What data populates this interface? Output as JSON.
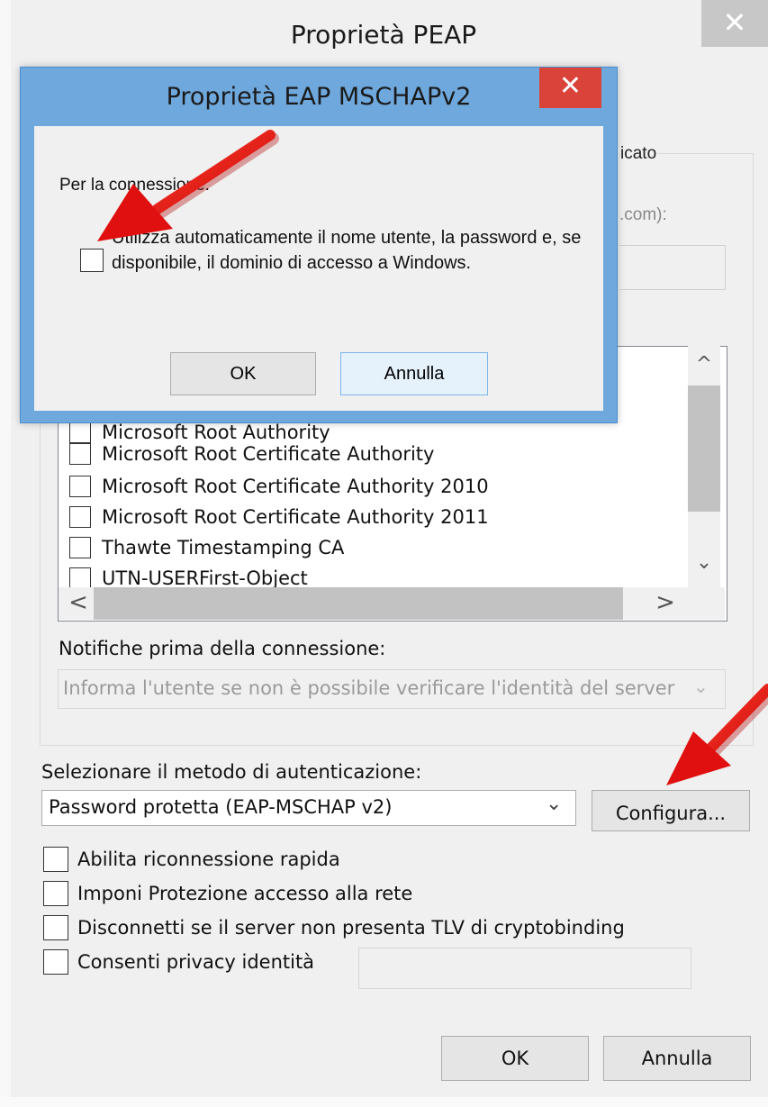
{
  "outer_window": {
    "title": "Proprietà PEAP",
    "close_glyph": "✕",
    "group_label_fragment": "icato",
    "server_label_fragment": ".com):",
    "cert_list": [
      {
        "label": "Microsoft Root Authority",
        "checked": false
      },
      {
        "label": "Microsoft Root Certificate Authority",
        "checked": false
      },
      {
        "label": "Microsoft Root Certificate Authority 2010",
        "checked": false
      },
      {
        "label": "Microsoft Root Certificate Authority 2011",
        "checked": false
      },
      {
        "label": "Thawte Timestamping CA",
        "checked": false
      },
      {
        "label": "UTN-USERFirst-Object",
        "checked": false
      }
    ],
    "scroll_up_glyph": "^",
    "scroll_down_glyph": "⌄",
    "scroll_left_glyph": "<",
    "scroll_right_glyph": ">",
    "notifications_label": "Notifiche prima della connessione:",
    "notifications_value": "Informa l'utente se non è possibile verificare l'identità del server",
    "auth_method_label": "Selezionare il metodo di autenticazione:",
    "auth_method_value": "Password protetta (EAP-MSCHAP v2)",
    "configure_button": "Configura...",
    "options": [
      {
        "label": "Abilita riconnessione rapida",
        "checked": false
      },
      {
        "label": "Imponi Protezione accesso alla rete",
        "checked": false
      },
      {
        "label": "Disconnetti se il server non presenta TLV di cryptobinding",
        "checked": false
      },
      {
        "label": "Consenti privacy identità",
        "checked": false
      }
    ],
    "ok_button": "OK",
    "cancel_button": "Annulla"
  },
  "inner_dialog": {
    "title": "Proprietà EAP MSCHAPv2",
    "close_glyph": "✕",
    "connection_label": "Per la connessione:",
    "auto_login_checkbox": {
      "label": "Utilizza automaticamente il nome utente, la password e, se disponibile, il dominio di accesso a Windows.",
      "checked": false
    },
    "ok_button": "OK",
    "cancel_button": "Annulla"
  },
  "colors": {
    "arrow": "#e01010",
    "dialog_frame": "#6fa8dc",
    "close_red": "#d9433a"
  }
}
